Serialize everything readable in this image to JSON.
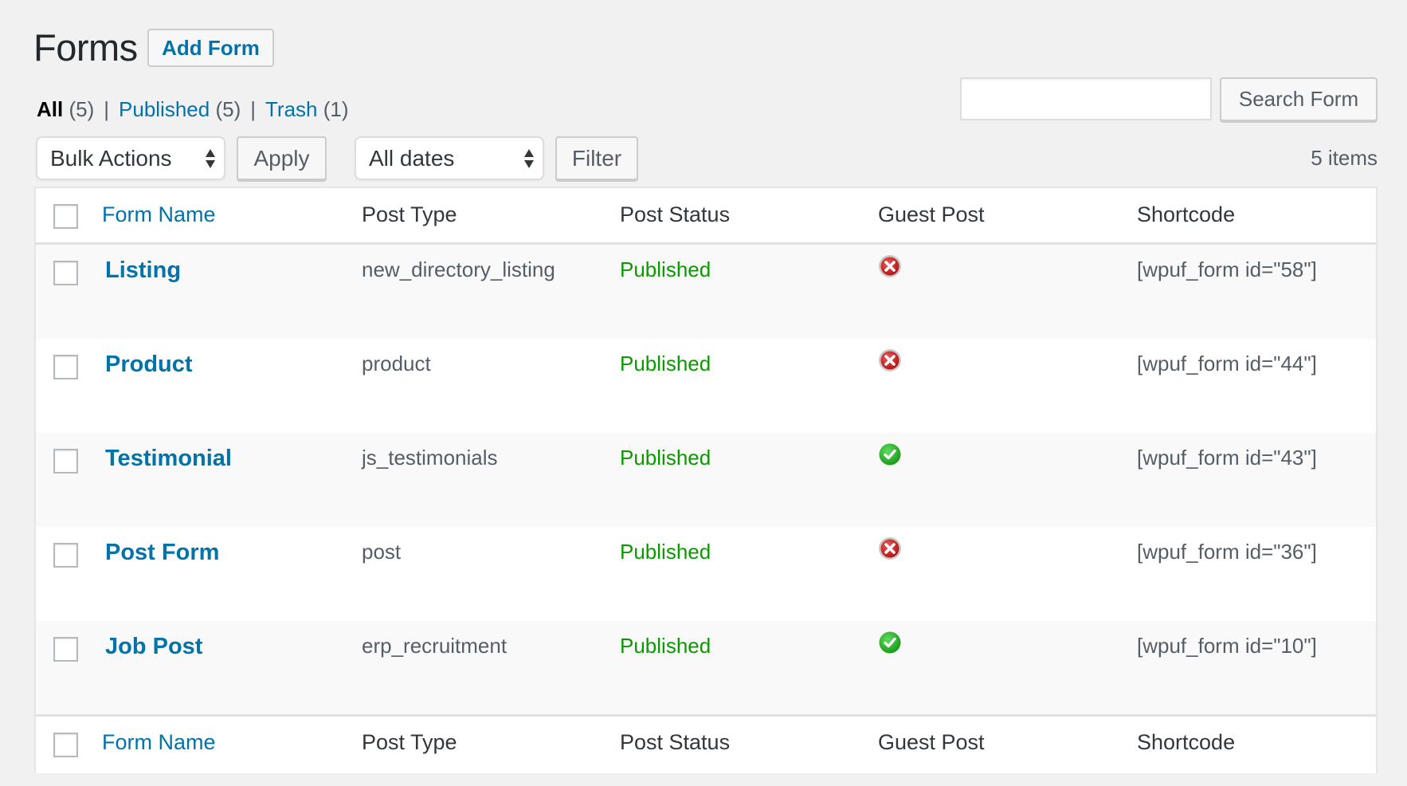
{
  "page": {
    "title": "Forms",
    "add_button": "Add Form"
  },
  "filters": {
    "all": {
      "label": "All",
      "count": "(5)"
    },
    "published": {
      "label": "Published",
      "count": "(5)"
    },
    "trash": {
      "label": "Trash",
      "count": "(1)"
    },
    "separator": "|"
  },
  "search": {
    "value": "",
    "placeholder": "",
    "button": "Search Form"
  },
  "toolbar": {
    "bulk_actions": "Bulk Actions",
    "apply": "Apply",
    "dates": "All dates",
    "filter": "Filter",
    "items_count": "5 items"
  },
  "table": {
    "columns": [
      "Form Name",
      "Post Type",
      "Post Status",
      "Guest Post",
      "Shortcode"
    ],
    "rows": [
      {
        "name": "Listing",
        "post_type": "new_directory_listing",
        "status": "Published",
        "guest_post": "disabled",
        "guest_icon": "x-circle-icon",
        "shortcode": "[wpuf_form id=\"58\"]"
      },
      {
        "name": "Product",
        "post_type": "product",
        "status": "Published",
        "guest_post": "disabled",
        "guest_icon": "x-circle-icon",
        "shortcode": "[wpuf_form id=\"44\"]"
      },
      {
        "name": "Testimonial",
        "post_type": "js_testimonials",
        "status": "Published",
        "guest_post": "enabled",
        "guest_icon": "check-circle-icon",
        "shortcode": "[wpuf_form id=\"43\"]"
      },
      {
        "name": "Post Form",
        "post_type": "post",
        "status": "Published",
        "guest_post": "disabled",
        "guest_icon": "x-circle-icon",
        "shortcode": "[wpuf_form id=\"36\"]"
      },
      {
        "name": "Job Post",
        "post_type": "erp_recruitment",
        "status": "Published",
        "guest_post": "enabled",
        "guest_icon": "check-circle-icon",
        "shortcode": "[wpuf_form id=\"10\"]"
      }
    ]
  },
  "colors": {
    "link": "#0073aa",
    "published": "#0a9a00",
    "guest_enabled": "#2fb52f",
    "guest_disabled": "#d32f2f"
  }
}
